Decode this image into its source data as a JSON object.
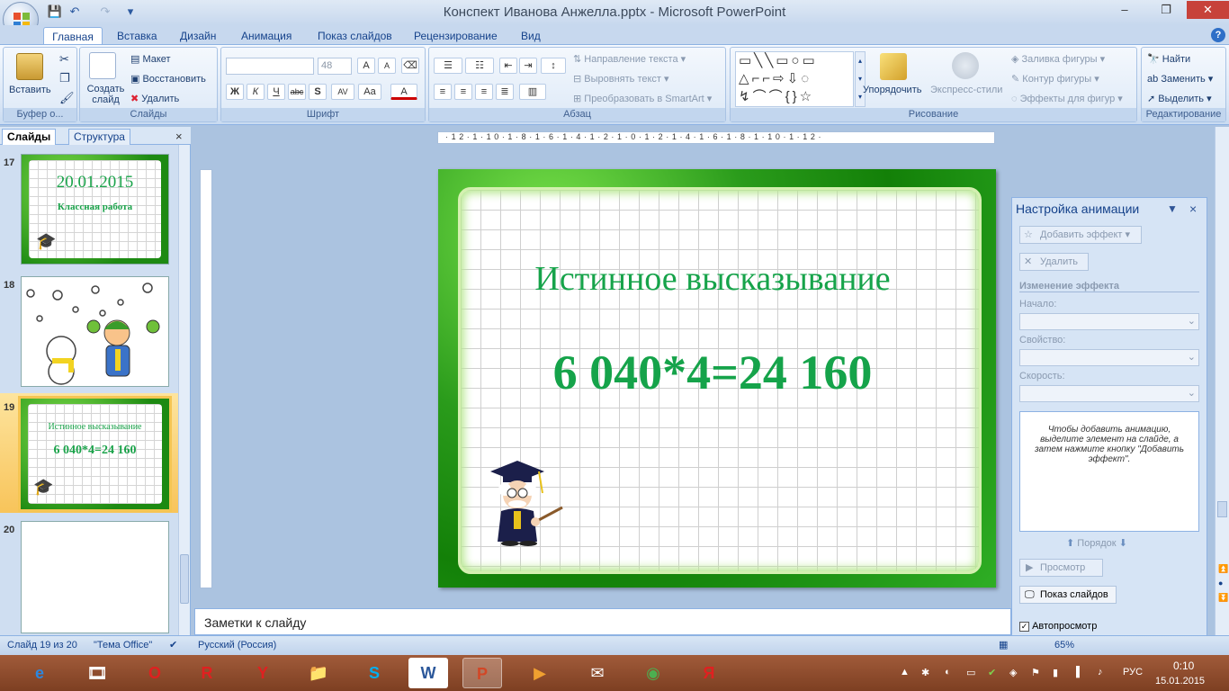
{
  "window": {
    "title": "Конспект Иванова Анжелла.pptx - Microsoft PowerPoint",
    "minimize": "‒",
    "maximize": "❐",
    "close": "✕"
  },
  "qat": {
    "save": "💾",
    "undo": "↶",
    "redo": "↷",
    "more": "▾"
  },
  "tabs": [
    "Главная",
    "Вставка",
    "Дизайн",
    "Анимация",
    "Показ слайдов",
    "Рецензирование",
    "Вид"
  ],
  "help": "?",
  "ribbon": {
    "clipboard": {
      "label": "Буфер о...",
      "paste": "Вставить"
    },
    "slides": {
      "label": "Слайды",
      "new_slide": "Создать слайд",
      "layout": "Макет",
      "reset": "Восстановить",
      "delete": "Удалить"
    },
    "font": {
      "label": "Шрифт",
      "size": "48",
      "bold": "Ж",
      "italic": "К",
      "underline": "Ч",
      "strike": "abc",
      "shadow": "S",
      "spacing": "AV",
      "case": "Aa",
      "color": "A"
    },
    "paragraph": {
      "label": "Абзац",
      "text_direction": "Направление текста",
      "align_text": "Выровнять текст",
      "smartart": "Преобразовать в SmartArt"
    },
    "drawing": {
      "label": "Рисование",
      "arrange": "Упорядочить",
      "quick_styles": "Экспресс-стили",
      "fill": "Заливка фигуры",
      "outline": "Контур фигуры",
      "effects": "Эффекты для фигур"
    },
    "editing": {
      "label": "Редактирование",
      "find": "Найти",
      "replace": "Заменить",
      "select": "Выделить"
    }
  },
  "left_pane": {
    "tab_slides": "Слайды",
    "tab_outline": "Структура",
    "close": "×",
    "slides": [
      {
        "num": "17",
        "date": "20.01.2015",
        "caption": "Классная работа"
      },
      {
        "num": "18"
      },
      {
        "num": "19",
        "caption": "Истинное высказывание",
        "eq": "6 040*4=24 160"
      },
      {
        "num": "20"
      }
    ]
  },
  "ruler": {
    "ticks": "·12·1·10·1·8·1·6·1·4·1·2·1·0·1·2·1·4·1·6·1·8·1·10·1·12·"
  },
  "slide": {
    "title": "Истинное высказывание",
    "equation": "6 040*4=24 160"
  },
  "notes": {
    "placeholder": "Заметки к слайду"
  },
  "animation_pane": {
    "title": "Настройка анимации",
    "add_effect": "Добавить эффект",
    "remove": "Удалить",
    "change_effect": "Изменение эффекта",
    "start": "Начало:",
    "property": "Свойство:",
    "speed": "Скорость:",
    "hint": "Чтобы добавить анимацию, выделите элемент на слайде, а затем нажмите кнопку \"Добавить эффект\".",
    "order": "Порядок",
    "preview": "Просмотр",
    "slideshow": "Показ слайдов",
    "autopreview": "Автопросмотр"
  },
  "status": {
    "slide": "Слайд 19 из 20",
    "theme": "\"Тема Office\"",
    "language": "Русский (Россия)",
    "zoom": "65%"
  },
  "taskbar": {
    "apps": [
      "e",
      "🎞",
      "O",
      "R",
      "Y",
      "📁",
      "S",
      "W",
      "P",
      "▶",
      "✉",
      "◉",
      "Я"
    ],
    "lang": "РУС",
    "time": "0:10",
    "date": "15.01.2015"
  }
}
